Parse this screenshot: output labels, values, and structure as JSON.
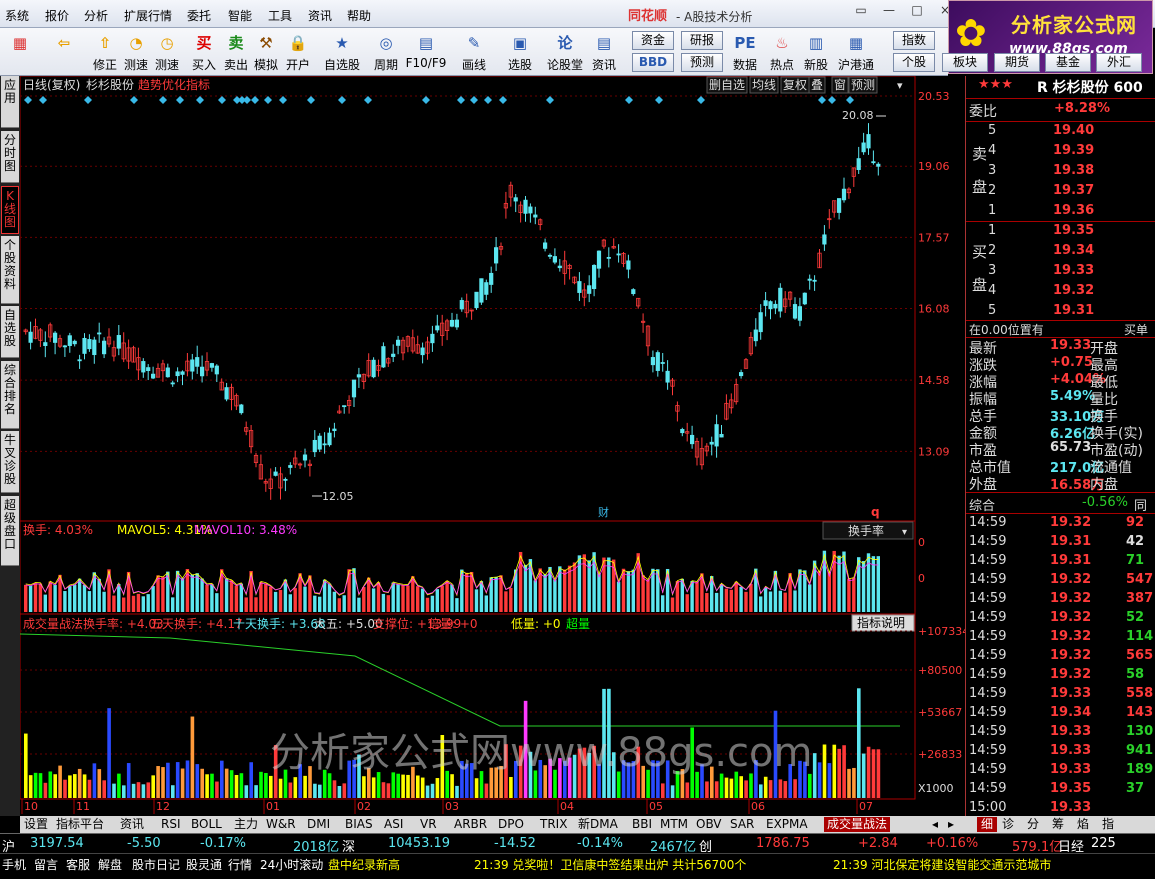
{
  "menu": [
    "系统",
    "报价",
    "分析",
    "扩展行情",
    "委托",
    "智能",
    "工具",
    "资讯",
    "帮助"
  ],
  "app": {
    "brand": "同花顺",
    "title": "- A股技术分析",
    "win_buttons": [
      "▭",
      "—",
      "□",
      "×"
    ]
  },
  "logo": {
    "name": "分析家公式网",
    "url": "www.88gs.com"
  },
  "toolbar": {
    "buttons": [
      {
        "name": "color-grid-icon",
        "label": ""
      },
      {
        "name": "back-arrow-icon",
        "label": ""
      },
      {
        "name": "up-arrow-icon",
        "label": "修正"
      },
      {
        "name": "measure-icon",
        "label": "测速"
      },
      {
        "name": "clock-icon",
        "label": "测速"
      },
      {
        "name": "buy-icon",
        "label": "买入",
        "glyph": "买"
      },
      {
        "name": "sell-icon",
        "label": "卖出",
        "glyph": "卖"
      },
      {
        "name": "hammer-icon",
        "label": "模拟"
      },
      {
        "name": "lock-icon",
        "label": "开户"
      },
      {
        "name": "star-icon",
        "label": "自选股"
      },
      {
        "name": "period-icon",
        "label": "周期"
      },
      {
        "name": "f10-icon",
        "label": "F10/F9"
      },
      {
        "name": "pen-icon",
        "label": "画线"
      },
      {
        "name": "stock-select-icon",
        "label": "选股"
      },
      {
        "name": "lun-icon",
        "label": "论股堂",
        "glyph": "论"
      },
      {
        "name": "doc-icon",
        "label": "资讯"
      },
      {
        "name": "pe-icon",
        "label": "数据",
        "glyph": "PE"
      },
      {
        "name": "hot-icon",
        "label": "热点"
      },
      {
        "name": "new-icon",
        "label": "新股"
      },
      {
        "name": "hk-icon",
        "label": "沪港通"
      }
    ],
    "small": [
      [
        "资金",
        "BBD"
      ],
      [
        "研报",
        "预测"
      ],
      [
        "指数",
        "个股"
      ],
      [
        "板块"
      ],
      [
        "期货"
      ],
      [
        "基金"
      ],
      [
        "外汇"
      ]
    ]
  },
  "left_tabs": [
    "应用",
    "分时图",
    "K线图",
    "个股资料",
    "自选股",
    "综合排名",
    "牛叉诊股",
    "超级盘口"
  ],
  "kline": {
    "header": [
      "日线(复权)",
      "杉杉股份"
    ],
    "indicator": "趋势优化指标",
    "toolbar": [
      "删自选",
      "均线",
      "复权",
      "叠",
      "窗",
      "预测"
    ],
    "price_axis": [
      "20.53",
      "19.06",
      "17.57",
      "16.08",
      "14.58",
      "13.09"
    ],
    "high_label": "20.08",
    "low_label": "12.05",
    "markers": [
      "财",
      "q"
    ]
  },
  "turnover": {
    "title": "换手: 4.03%",
    "mavol5": "MAVOL5: 4.31%",
    "mavol10": "MAVOL10: 3.48%",
    "selector": "换手率",
    "axis": [
      "0",
      "0"
    ]
  },
  "volstrat": {
    "name": "成交量战法",
    "items": [
      "换手率: +4.03",
      "五天换手: +4.17",
      "十天换手: +3.68",
      "大五: +5.00",
      "支撑位: +13.99",
      "倍量: +0",
      "低量: +0",
      "超量"
    ],
    "button": "指标说明",
    "axis": [
      "+107334",
      "+80500",
      "+53667",
      "+26833",
      "X1000"
    ],
    "watermark": "分析家公式网www.88gs.com"
  },
  "date_axis": [
    "10",
    "11",
    "12",
    "01",
    "02",
    "03",
    "04",
    "05",
    "06",
    "07"
  ],
  "right_panel": {
    "stars": "★★★",
    "code": "R 杉杉股份 600",
    "weibi_label": "委比",
    "weibi": "+8.28%",
    "sell_label": "卖盘",
    "buy_label": "买盘",
    "sell": [
      [
        "5",
        "19.40"
      ],
      [
        "4",
        "19.39"
      ],
      [
        "3",
        "19.38"
      ],
      [
        "2",
        "19.37"
      ],
      [
        "1",
        "19.36"
      ]
    ],
    "buy": [
      [
        "1",
        "19.35"
      ],
      [
        "2",
        "19.34"
      ],
      [
        "3",
        "19.33"
      ],
      [
        "4",
        "19.32"
      ],
      [
        "5",
        "19.31"
      ]
    ],
    "position": "在0.00位置有",
    "position_right": "买单",
    "quote": [
      [
        "最新",
        "19.33",
        "开盘"
      ],
      [
        "涨跌",
        "+0.75",
        "最高"
      ],
      [
        "涨幅",
        "+4.04%",
        "最低"
      ],
      [
        "振幅",
        "5.49%",
        "量比"
      ],
      [
        "总手",
        "33.10万",
        "换手"
      ],
      [
        "金额",
        "6.26亿",
        "换手(实)"
      ],
      [
        "市盈",
        "65.73",
        "市盈(动)"
      ],
      [
        "总市值",
        "217.0亿",
        "流通值"
      ],
      [
        "外盘",
        "16.58万",
        "内盘"
      ]
    ],
    "composite_label": "综合",
    "composite": "-0.56%",
    "composite_right": "同",
    "ticks": [
      [
        "14:59",
        "19.32",
        "92"
      ],
      [
        "14:59",
        "19.31",
        "42"
      ],
      [
        "14:59",
        "19.31",
        "71"
      ],
      [
        "14:59",
        "19.32",
        "547"
      ],
      [
        "14:59",
        "19.32",
        "387"
      ],
      [
        "14:59",
        "19.32",
        "52"
      ],
      [
        "14:59",
        "19.32",
        "114"
      ],
      [
        "14:59",
        "19.32",
        "565"
      ],
      [
        "14:59",
        "19.32",
        "58"
      ],
      [
        "14:59",
        "19.33",
        "558"
      ],
      [
        "14:59",
        "19.34",
        "143"
      ],
      [
        "14:59",
        "19.33",
        "130"
      ],
      [
        "14:59",
        "19.33",
        "941"
      ],
      [
        "14:59",
        "19.33",
        "189"
      ],
      [
        "14:59",
        "19.35",
        "37"
      ],
      [
        "15:00",
        "19.33",
        ""
      ]
    ]
  },
  "bottom_tabs": [
    "设置",
    "指标平台",
    "资讯",
    "RSI",
    "BOLL",
    "主力",
    "W&R",
    "DMI",
    "BIAS",
    "ASI",
    "VR",
    "ARBR",
    "DPO",
    "TRIX",
    "新DMA",
    "BBI",
    "MTM",
    "OBV",
    "SAR",
    "EXPMA",
    "成交量战法"
  ],
  "bottom_right_tabs": [
    "细",
    "诊",
    "分",
    "筹",
    "焰",
    "指"
  ],
  "index_bar": {
    "sh_label": "沪",
    "sh_val": "3197.54",
    "sh_chg": "-5.50",
    "sh_pct": "-0.17%",
    "sh_amt": "2018亿",
    "sz_label": "深",
    "sz_val": "10453.19",
    "sz_chg": "-14.52",
    "sz_pct": "-0.14%",
    "sz_amt": "2467亿",
    "cy_label": "创",
    "cy_val": "1786.75",
    "cy_chg": "+2.84",
    "cy_pct": "+0.16%",
    "cy_amt": "579.1亿",
    "rj_label": "日经",
    "rj_val": "225"
  },
  "status_bar": {
    "items": [
      "手机",
      "留言",
      "客服",
      "解盘",
      "股市日记",
      "股灵通",
      "行情",
      "24小时滚动"
    ],
    "news1": "盘中纪录新高",
    "news2": "21:39 兑奖啦！卫信康中签结果出炉 共计56700个",
    "news3": "21:39 河北保定将建设智能交通示范城市"
  },
  "colors": {
    "up": "#ff3a3a",
    "down": "#5ce6f0",
    "bg": "#000000",
    "grid": "#7a0000",
    "yellow": "#ffff00"
  }
}
